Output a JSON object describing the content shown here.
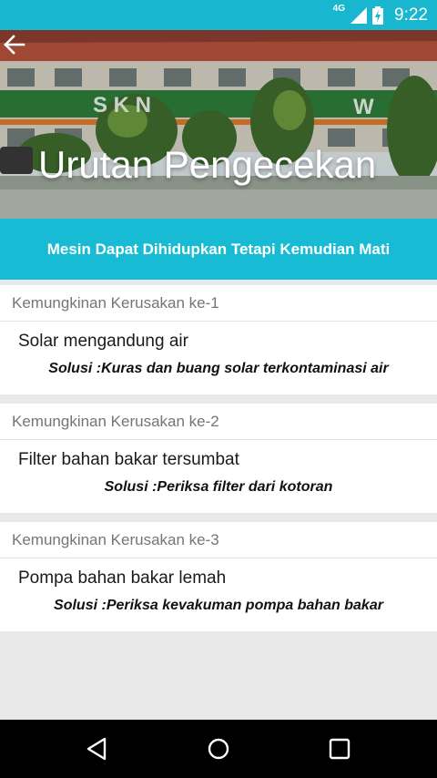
{
  "status_bar": {
    "network": "4G",
    "time": "9:22",
    "icons": [
      "signal-icon",
      "battery-charging-icon"
    ]
  },
  "header": {
    "title": "Urutan Pengecekan",
    "back_icon": "arrow-left-icon",
    "background": "school-building-photo",
    "building_sign": "S K N",
    "building_sign_right": "W"
  },
  "problem": {
    "title": "Mesin Dapat Dihidupkan Tetapi Kemudian Mati"
  },
  "items": [
    {
      "header": "Kemungkinan Kerusakan ke-1",
      "cause": "Solar mengandung air",
      "solution": "Solusi :Kuras dan buang solar terkontaminasi air"
    },
    {
      "header": "Kemungkinan Kerusakan ke-2",
      "cause": "Filter bahan bakar tersumbat",
      "solution": "Solusi :Periksa filter dari kotoran"
    },
    {
      "header": "Kemungkinan Kerusakan ke-3",
      "cause": "Pompa bahan bakar lemah",
      "solution": "Solusi :Periksa kevakuman pompa bahan bakar"
    }
  ],
  "nav": {
    "back": "nav-back-icon",
    "home": "nav-home-icon",
    "recents": "nav-recents-icon"
  },
  "colors": {
    "accent": "#17bcd4",
    "status_bar": "#18b7cf",
    "background": "#e9e9e9"
  }
}
